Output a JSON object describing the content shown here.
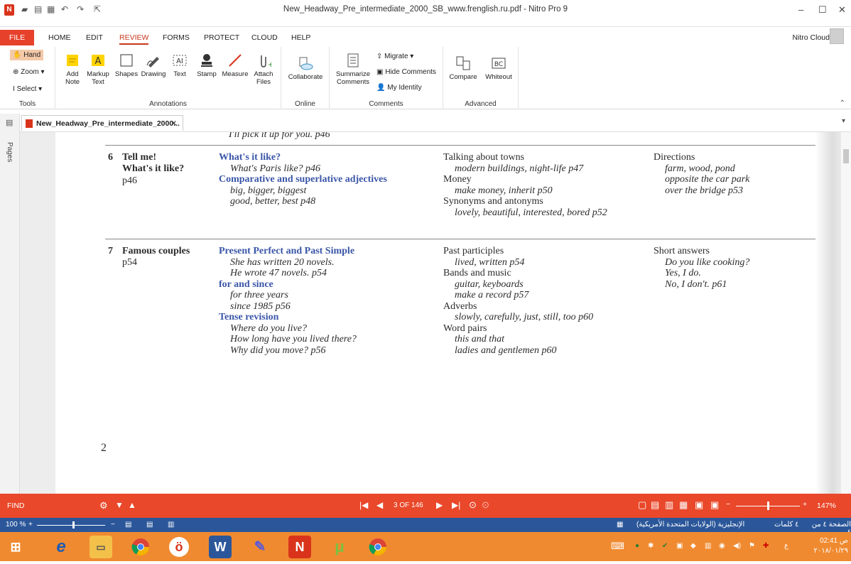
{
  "window": {
    "title": "New_Headway_Pre_intermediate_2000_SB_www.frenglish.ru.pdf - Nitro Pro 9",
    "minimize": "–",
    "maximize": "☐",
    "close": "✕"
  },
  "tabs": [
    "FILE",
    "HOME",
    "EDIT",
    "REVIEW",
    "FORMS",
    "PROTECT",
    "CLOUD",
    "HELP"
  ],
  "account": "Nitro Cloud",
  "ribbon": {
    "tools": {
      "hand": "Hand",
      "zoom": "Zoom",
      "select": "Select",
      "label": "Tools"
    },
    "annotations": {
      "add_note": "Add Note",
      "markup_text": "Markup Text",
      "shapes": "Shapes",
      "drawing": "Drawing",
      "text": "Text",
      "stamp": "Stamp",
      "measure": "Measure",
      "attach_files": "Attach Files",
      "label": "Annotations"
    },
    "online": {
      "collaborate": "Collaborate",
      "label": "Online"
    },
    "comments": {
      "summarize": "Summarize Comments",
      "migrate": "Migrate",
      "hide": "Hide Comments",
      "identity": "My Identity",
      "label": "Comments"
    },
    "advanced": {
      "compare": "Compare",
      "whiteout": "Whiteout",
      "label": "Advanced"
    }
  },
  "doc_tab": "New_Headway_Pre_intermediate_2000...",
  "doc_tab_close": "✕",
  "sidebar_label": "Pages",
  "page": {
    "top_cut": "I'll pick it up for you.  p46",
    "unit6": {
      "num": "6",
      "title1": "Tell me!",
      "title2": "What's it like?",
      "page": "p46",
      "grammar": [
        {
          "t": "h",
          "v": "What's it like?"
        },
        {
          "t": "i",
          "v": "What's Paris like?  p46"
        },
        {
          "t": "h",
          "v": "Comparative and superlative adjectives"
        },
        {
          "t": "i",
          "v": "big, bigger, biggest"
        },
        {
          "t": "i",
          "v": "good, better, best  p48"
        }
      ],
      "vocab": [
        {
          "t": "n",
          "v": "Talking about towns"
        },
        {
          "t": "i",
          "v": "modern buildings, night-life  p47"
        },
        {
          "t": "n",
          "v": "Money"
        },
        {
          "t": "i",
          "v": "make money, inherit  p50"
        },
        {
          "t": "n",
          "v": "Synonyms and antonyms"
        },
        {
          "t": "i",
          "v": "lovely, beautiful, interested, bored  p52"
        }
      ],
      "everyday": [
        {
          "t": "n",
          "v": "Directions"
        },
        {
          "t": "i",
          "v": "farm, wood, pond"
        },
        {
          "t": "i",
          "v": "opposite the car park"
        },
        {
          "t": "i",
          "v": "over the bridge  p53"
        }
      ]
    },
    "unit7": {
      "num": "7",
      "title1": "Famous couples",
      "page": "p54",
      "grammar": [
        {
          "t": "h",
          "v": "Present Perfect and Past Simple"
        },
        {
          "t": "i",
          "v": "She has written 20 novels."
        },
        {
          "t": "i",
          "v": "He wrote 47 novels.  p54"
        },
        {
          "t": "h",
          "v": "for and since"
        },
        {
          "t": "i",
          "v": "for three years"
        },
        {
          "t": "i",
          "v": "since 1985  p56"
        },
        {
          "t": "h",
          "v": "Tense revision"
        },
        {
          "t": "i",
          "v": "Where do you live?"
        },
        {
          "t": "i",
          "v": "How long have you lived there?"
        },
        {
          "t": "i",
          "v": "Why did you move?  p56"
        }
      ],
      "vocab": [
        {
          "t": "n",
          "v": "Past participles"
        },
        {
          "t": "i",
          "v": "lived, written  p54"
        },
        {
          "t": "n",
          "v": "Bands and music"
        },
        {
          "t": "i",
          "v": "guitar, keyboards"
        },
        {
          "t": "i",
          "v": "make a record  p57"
        },
        {
          "t": "n",
          "v": "Adverbs"
        },
        {
          "t": "i",
          "v": "slowly, carefully, just, still, too  p60"
        },
        {
          "t": "n",
          "v": "Word pairs"
        },
        {
          "t": "i",
          "v": "this and that"
        },
        {
          "t": "i",
          "v": "ladies and gentlemen  p60"
        }
      ],
      "everyday": [
        {
          "t": "n",
          "v": "Short answers"
        },
        {
          "t": "i",
          "v": "Do you like cooking?"
        },
        {
          "t": "i",
          "v": "Yes, I do."
        },
        {
          "t": "i",
          "v": "No, I don't.  p61"
        }
      ]
    },
    "page_number": "2"
  },
  "findbar": {
    "find": "FIND",
    "page_indicator": "3 OF 146",
    "zoom": "147%"
  },
  "status": {
    "zoom": "100 %",
    "lang": "الإنجليزية (الولايات المتحدة الأمريكية)",
    "words": "٤ كلمات",
    "page": "الصفحة ٤ من ٤"
  },
  "clock": {
    "time": "02:41 ص",
    "date": "٢٠١٨/٠١/٢٩"
  },
  "colors": {
    "accent": "#e9482a",
    "heading_blue": "#3a56a8",
    "status_blue": "#2b579a",
    "taskbar": "#f08a30"
  }
}
